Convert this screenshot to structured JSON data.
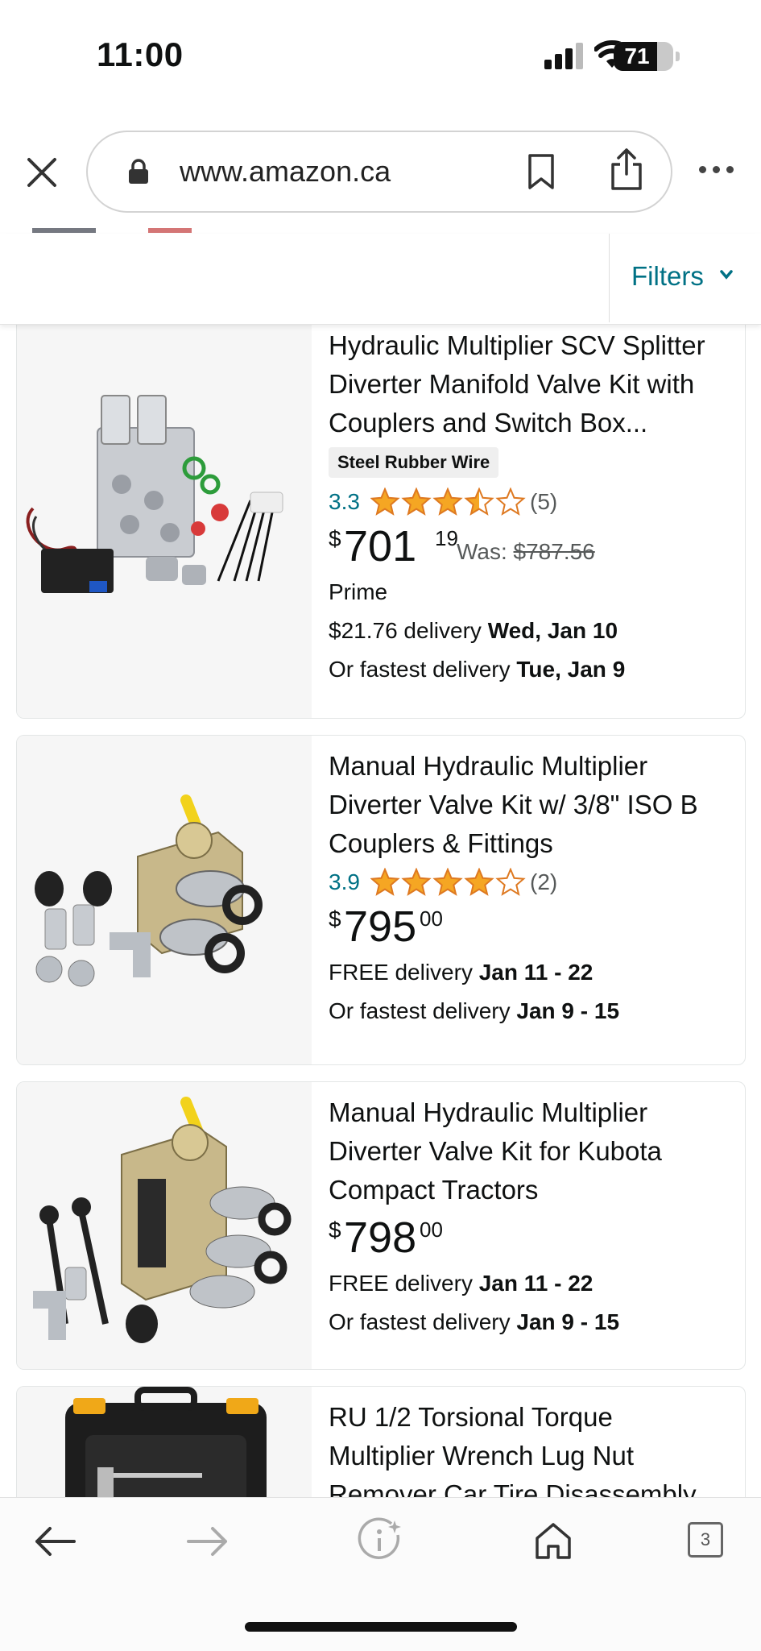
{
  "status_bar": {
    "time": "11:00",
    "battery": "71"
  },
  "browser": {
    "url": "www.amazon.ca",
    "tab_count": "3"
  },
  "filters": {
    "label": "Filters"
  },
  "products": [
    {
      "title": "Hydraulic Multiplier SCV Splitter Diverter Manifold Valve Kit with Couplers and Switch Box...",
      "badge": "Steel Rubber Wire",
      "rating": "3.3",
      "rating_count": "(5)",
      "price_symbol": "$",
      "price_whole": "701",
      "price_fraction": "19",
      "was_label": "Was:",
      "was_price": "$787.56",
      "prime": "Prime",
      "delivery_text": "$21.76 delivery ",
      "delivery_date": "Wed, Jan 10",
      "fastest_text": "Or fastest delivery ",
      "fastest_date": "Tue, Jan 9"
    },
    {
      "title": "Manual Hydraulic Multiplier Diverter Valve Kit w/ 3/8\" ISO B Couplers & Fittings",
      "rating": "3.9",
      "rating_count": "(2)",
      "price_symbol": "$",
      "price_whole": "795",
      "price_fraction": "00",
      "delivery_text": "FREE delivery ",
      "delivery_date": "Jan 11 - 22",
      "fastest_text": "Or fastest delivery ",
      "fastest_date": "Jan 9 - 15"
    },
    {
      "title": "Manual Hydraulic Multiplier Diverter Valve Kit for Kubota Compact Tractors",
      "price_symbol": "$",
      "price_whole": "798",
      "price_fraction": "00",
      "delivery_text": "FREE delivery ",
      "delivery_date": "Jan 11 - 22",
      "fastest_text": "Or fastest delivery ",
      "fastest_date": "Jan 9 - 15"
    },
    {
      "title_line1": "RU 1/2 Torsional Torque",
      "title_line2": "Multiplier Wrench Lug Nut",
      "title_line3": "Remover Car Tire Disassembly"
    }
  ],
  "colors": {
    "link": "#007185",
    "star": "#f5a623",
    "text": "#0f1111",
    "muted": "#565959"
  },
  "icons": [
    "close-icon",
    "lock-icon",
    "bookmark-icon",
    "share-icon",
    "more-icon",
    "chevron-down-icon",
    "back-icon",
    "forward-icon",
    "info-icon",
    "home-icon",
    "tabs-icon"
  ]
}
